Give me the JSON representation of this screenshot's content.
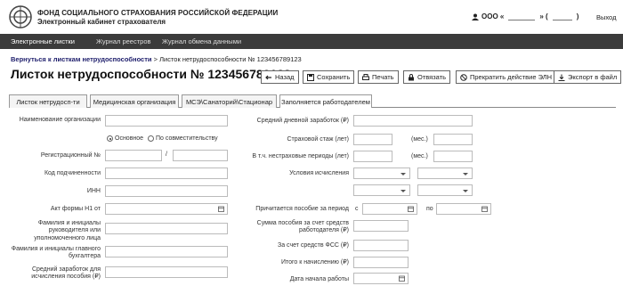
{
  "header": {
    "org_title": "ФОНД СОЦИАЛЬНОГО СТРАХОВАНИЯ РОССИЙСКОЙ ФЕДЕРАЦИИ",
    "org_subtitle": "Электронный кабинет страхователя",
    "user_prefix": "ООО «",
    "user_mid": "» (",
    "user_suffix": ")",
    "exit_label": "Выход"
  },
  "nav": {
    "items": [
      "Электронные листки",
      "Журнал реестров",
      "Журнал обмена данными"
    ]
  },
  "breadcrumb": {
    "back_link": "Вернуться к листкам нетрудоспособности",
    "separator": ">",
    "current": "Листок нетрудоспособности № 123456789123"
  },
  "page_title": "Листок нетрудоспособности № 123456789123",
  "toolbar": {
    "back": "Назад",
    "save": "Сохранить",
    "print": "Печать",
    "unbind": "Отвязать",
    "stop": "Прекратить действие ЭЛН",
    "export": "Экспорт в файл"
  },
  "tabs": [
    "Листок нетрудосп-ти",
    "Медицинская организация",
    "МСЭ\\Санаторий\\Стационар",
    "Заполняется работодателем"
  ],
  "form_left": {
    "org_name": "Наименование организации",
    "radio_main": "Основное",
    "radio_part": "По совместительству",
    "reg_num": "Регистрационный №",
    "slash": "/",
    "sub_code": "Код подчиненности",
    "inn": "ИНН",
    "act_n1": "Акт формы Н1 от",
    "head_name": "Фамилия и инициалы руководителя или уполномоченного лица",
    "chief_acc": "Фамилия и инициалы главного бухгалтера",
    "avg_earn": "Средний заработок для исчисления пособия (₽)"
  },
  "form_right": {
    "avg_daily": "Средний дневной заработок (₽)",
    "ins_years": "Страховой стаж (лет)",
    "months": "(мес.)",
    "non_ins": "В т.ч. нестраховые периоды (лет)",
    "months2": "(мес.)",
    "calc_cond": "Условия исчисления",
    "period": "Причитается пособие за период",
    "from": "с",
    "to": "по",
    "sum_employer": "Сумма пособия за счет средств работодателя (₽)",
    "sum_fss": "За счет средств ФСС (₽)",
    "total": "Итого к начислению (₽)",
    "start_date": "Дата начала работы"
  }
}
